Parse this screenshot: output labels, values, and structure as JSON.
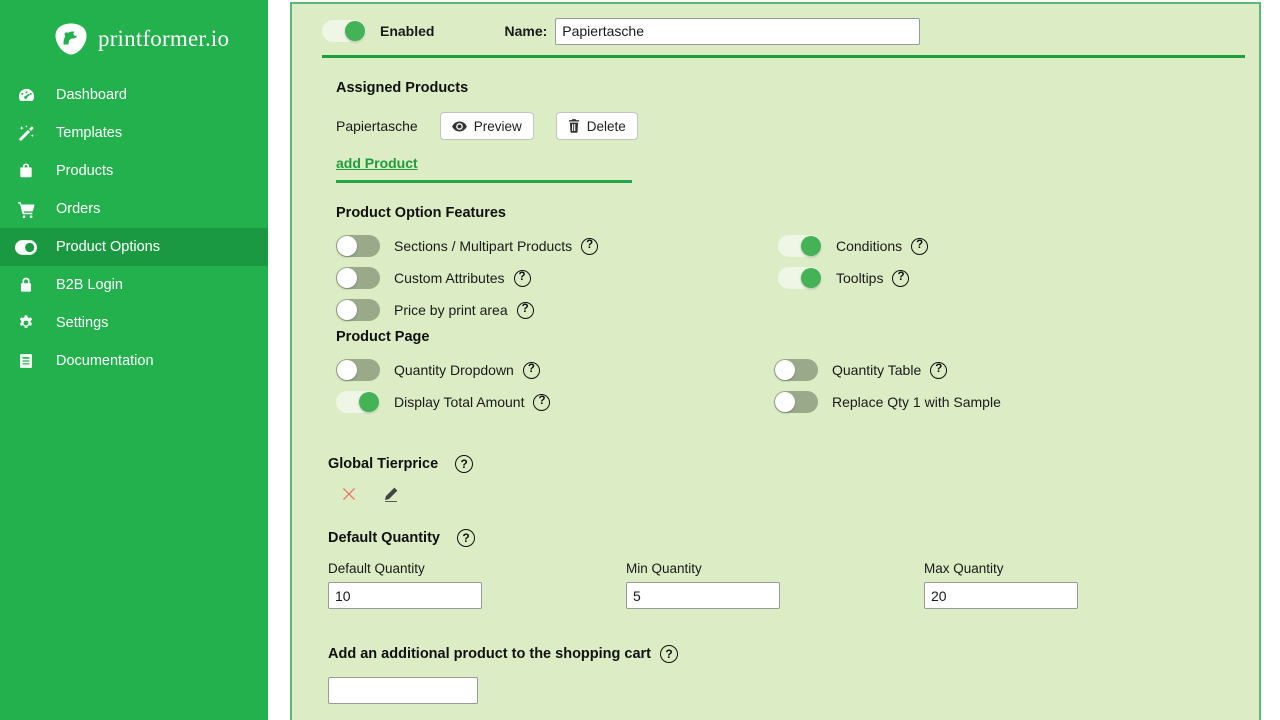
{
  "brand": {
    "name": "printformer.io",
    "logo_icon": "printformer-logo-icon",
    "sidebar_color": "#22b14c",
    "active_color": "#1b9942"
  },
  "sidebar": {
    "items": [
      {
        "label": "Dashboard",
        "icon": "dashboard-icon",
        "active": false
      },
      {
        "label": "Templates",
        "icon": "magic-wand-icon",
        "active": false
      },
      {
        "label": "Products",
        "icon": "shopping-bag-icon",
        "active": false
      },
      {
        "label": "Orders",
        "icon": "shopping-cart-icon",
        "active": false
      },
      {
        "label": "Product Options",
        "icon": "toggle-on-icon",
        "active": true
      },
      {
        "label": "B2B Login",
        "icon": "lock-icon",
        "active": false
      },
      {
        "label": "Settings",
        "icon": "gear-icon",
        "active": false
      },
      {
        "label": "Documentation",
        "icon": "book-icon",
        "active": false
      }
    ]
  },
  "header": {
    "enabled_label": "Enabled",
    "enabled_state": "on",
    "name_label": "Name:",
    "name_value": "Papiertasche",
    "name_placeholder": ""
  },
  "assigned_products": {
    "title": "Assigned Products",
    "rows": [
      {
        "name": "Papiertasche",
        "preview_label": "Preview",
        "preview_icon": "eye-icon",
        "delete_label": "Delete",
        "delete_icon": "trash-icon"
      }
    ],
    "add_link": "add Product"
  },
  "product_option_features": {
    "title": "Product Option Features",
    "left": [
      {
        "label": "Sections / Multipart Products",
        "state": "off",
        "help": "?"
      },
      {
        "label": "Custom Attributes",
        "state": "off",
        "help": "?"
      },
      {
        "label": "Price by print area",
        "state": "off",
        "help": "?"
      }
    ],
    "right": [
      {
        "label": "Conditions",
        "state": "on",
        "help": "?"
      },
      {
        "label": "Tooltips",
        "state": "on",
        "help": "?"
      }
    ]
  },
  "product_page": {
    "title": "Product Page",
    "left": [
      {
        "label": "Quantity Dropdown",
        "state": "off",
        "help": "?"
      },
      {
        "label": "Display Total Amount",
        "state": "on",
        "help": "?"
      }
    ],
    "right": [
      {
        "label": "Quantity Table",
        "state": "off",
        "help": "?"
      },
      {
        "label": "Replace Qty 1 with Sample",
        "state": "off",
        "help": ""
      }
    ]
  },
  "global_tierprice": {
    "title": "Global Tierprice",
    "help": "?",
    "delete_icon": "close-x-icon",
    "edit_icon": "pencil-icon",
    "delete_color": "#e8756b"
  },
  "default_quantity": {
    "title": "Default Quantity",
    "help": "?",
    "fields": [
      {
        "label": "Default Quantity",
        "value": "10"
      },
      {
        "label": "Min Quantity",
        "value": "5"
      },
      {
        "label": "Max Quantity",
        "value": "20"
      }
    ]
  },
  "additional_product": {
    "title": "Add an additional product to the shopping cart",
    "help": "?",
    "value": "",
    "placeholder": ""
  }
}
